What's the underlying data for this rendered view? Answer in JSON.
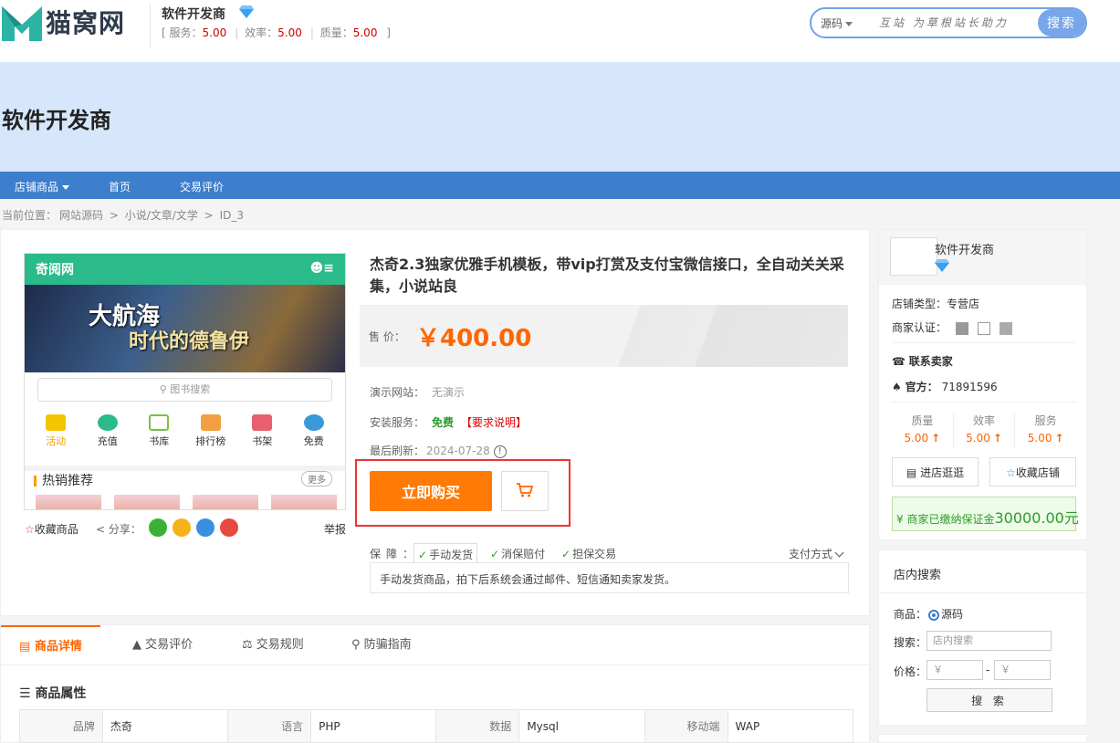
{
  "header": {
    "logo_text": "猫窝网",
    "shop_name": "软件开发商",
    "ratings": [
      {
        "label": "服务：",
        "value": "5.00"
      },
      {
        "label": "效率：",
        "value": "5.00"
      },
      {
        "label": "质量：",
        "value": "5.00"
      }
    ],
    "search": {
      "category": "源码",
      "placeholder": "互站 为草根站长助力",
      "button": "搜索"
    }
  },
  "banner": {
    "title": "软件开发商"
  },
  "nav": {
    "items": [
      "店铺商品",
      "首页",
      "交易评价"
    ]
  },
  "breadcrumb": {
    "prefix": "当前位置：",
    "items": [
      "网站源码",
      "小说/文章/文学",
      "ID_3"
    ],
    "separator": ">"
  },
  "product": {
    "title": "杰奇2.3独家优雅手机模板，带vip打赏及支付宝微信接口，全自动关关采集，小说站良",
    "price_label": "售 价：",
    "price": "￥400.00",
    "demo_label": "演示网站：",
    "demo_value": "无演示",
    "install_label": "安装服务：",
    "install_free": "免费",
    "install_note": "【要求说明】",
    "updated_label": "最后刷新：",
    "updated_value": "2024-07-28",
    "buy_button": "立即购买",
    "guarantee_label": "保障：",
    "guarantees": [
      "手动发货",
      "消保赔付",
      "担保交易"
    ],
    "pay_methods": "支付方式",
    "guarantee_desc": "手动发货商品，拍下后系统会通过邮件、短信通知卖家发货。",
    "image": {
      "app_name": "奇阅网",
      "banner_line1": "大航海",
      "banner_line2": "时代的德鲁伊",
      "search_placeholder": "图书搜索",
      "icons": [
        "活动",
        "充值",
        "书库",
        "排行榜",
        "书架",
        "免费"
      ],
      "hot_title": "热销推荐",
      "more": "更多"
    },
    "actions": {
      "favorite": "收藏商品",
      "share": "分享：",
      "report": "举报"
    }
  },
  "tabs": {
    "items": [
      "商品详情",
      "交易评价",
      "交易规则",
      "防骗指南"
    ],
    "attr_title": "商品属性",
    "attrs": [
      {
        "k": "品牌",
        "v": "杰奇"
      },
      {
        "k": "语言",
        "v": "PHP"
      },
      {
        "k": "数据",
        "v": "Mysql"
      },
      {
        "k": "移动端",
        "v": "WAP"
      }
    ]
  },
  "sidebar": {
    "shop_name": "软件开发商",
    "shop_type_label": "店铺类型：",
    "shop_type": "专营店",
    "cert_label": "商家认证：",
    "contact_title": "联系卖家",
    "qq_label": "官方：",
    "qq_value": "71891596",
    "metrics": [
      {
        "label": "质量",
        "value": "5.00"
      },
      {
        "label": "效率",
        "value": "5.00"
      },
      {
        "label": "服务",
        "value": "5.00"
      }
    ],
    "visit_button": "进店逛逛",
    "collect_button": "收藏店铺",
    "deposit_text": "商家已缴纳保证金",
    "deposit_amount": "30000.00元",
    "search_title": "店内搜索",
    "goods_label": "商品：",
    "goods_option": "源码",
    "search_label": "搜索：",
    "search_placeholder": "店内搜索",
    "price_label": "价格：",
    "price_placeholder": "￥",
    "price_dash": "-",
    "search_button": "搜 索"
  },
  "colors": {
    "brand_blue": "#3d7ecd",
    "accent_orange": "#ff7b05",
    "price_orange": "#ff6600",
    "banner_bg": "#d6e7fb",
    "highlight_red": "#ee3333"
  }
}
